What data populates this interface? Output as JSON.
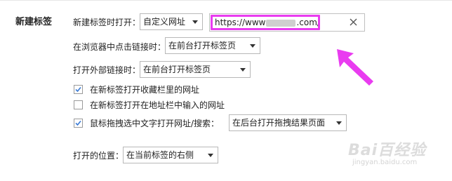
{
  "section_title": "新建标签",
  "new_tab_open": {
    "label": "新建标签时打开：",
    "selected": "自定义网址",
    "url_value_prefix": "https://www",
    "url_value_suffix": ".com/"
  },
  "link_click": {
    "label": "在浏览器中点击链接时：",
    "selected": "在前台打开标签页"
  },
  "external_link": {
    "label": "打开外部链接时：",
    "selected": "在前台打开标签页"
  },
  "checkboxes": [
    {
      "label": "在新标签打开收藏栏里的网址",
      "checked": true
    },
    {
      "label": "在新标签打开在地址栏中输入的网址",
      "checked": false
    },
    {
      "label": "鼠标拖拽选中文字打开网址/搜索：",
      "checked": true
    }
  ],
  "drag_select": {
    "selected": "在后台打开拖拽结果页面"
  },
  "open_position": {
    "label": "打开的位置：",
    "selected": "在当前标签的右侧"
  },
  "watermark": {
    "main": "Bai百经验",
    "sub": "jingyan.baidu.com"
  },
  "colors": {
    "highlight": "#e93cf0",
    "arrow": "#e93cf0",
    "checkbox_check": "#3a7bd5"
  }
}
